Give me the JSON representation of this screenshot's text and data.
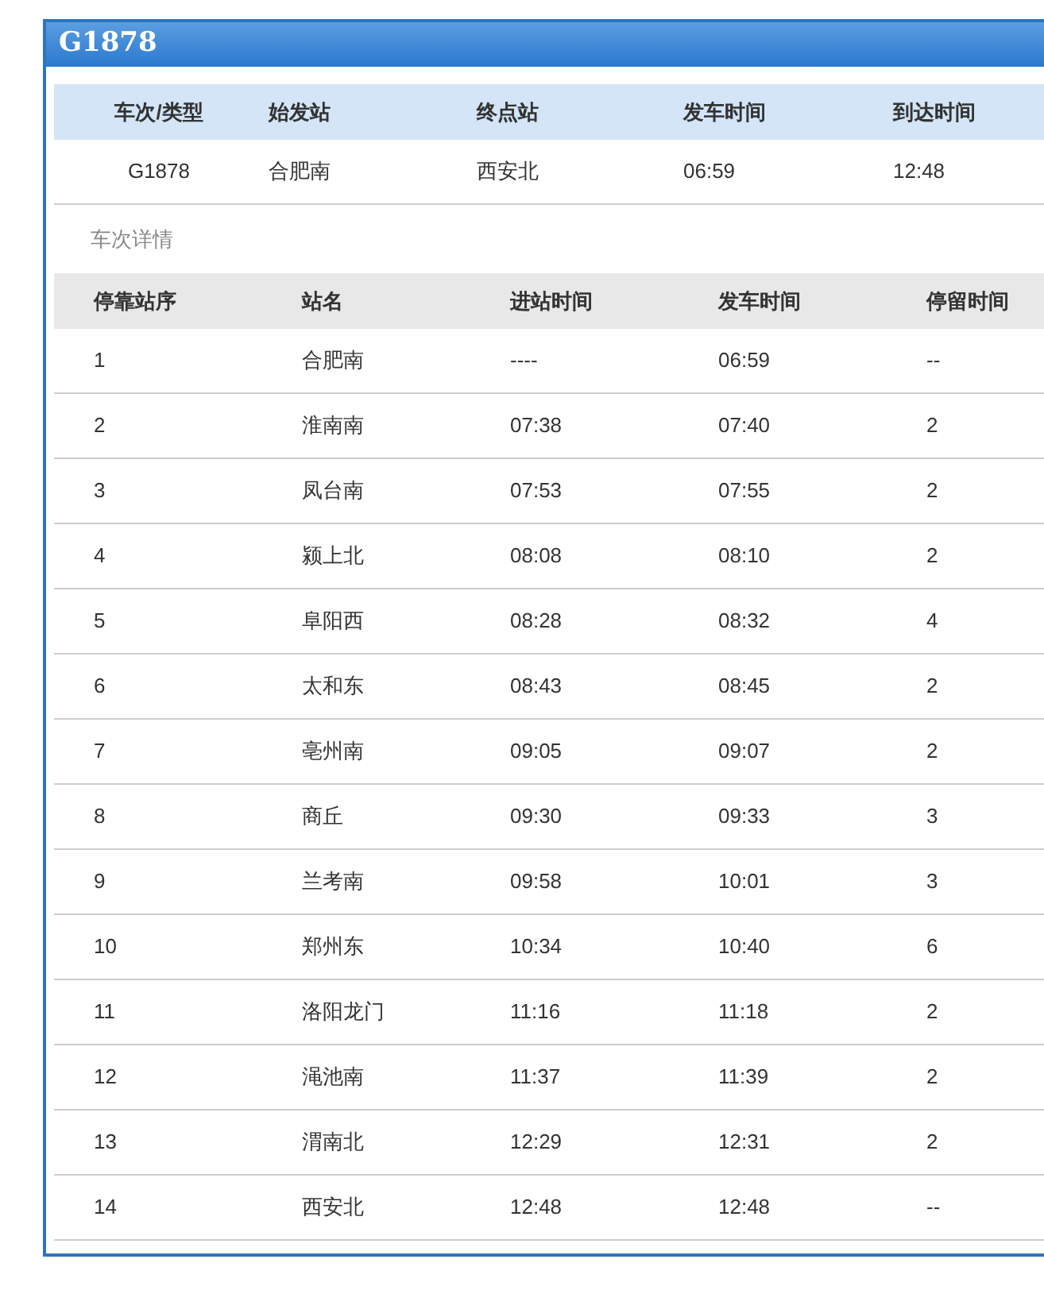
{
  "panel": {
    "title": "G1878"
  },
  "summary": {
    "columns": [
      "车次/类型",
      "始发站",
      "终点站",
      "发车时间",
      "到达时间"
    ],
    "row": [
      "G1878",
      "合肥南",
      "西安北",
      "06:59",
      "12:48"
    ]
  },
  "details": {
    "heading": "车次详情",
    "columns": [
      "停靠站序",
      "站名",
      "进站时间",
      "发车时间",
      "停留时间"
    ],
    "rows": [
      [
        "1",
        "合肥南",
        "----",
        "06:59",
        "--"
      ],
      [
        "2",
        "淮南南",
        "07:38",
        "07:40",
        "2"
      ],
      [
        "3",
        "凤台南",
        "07:53",
        "07:55",
        "2"
      ],
      [
        "4",
        "颍上北",
        "08:08",
        "08:10",
        "2"
      ],
      [
        "5",
        "阜阳西",
        "08:28",
        "08:32",
        "4"
      ],
      [
        "6",
        "太和东",
        "08:43",
        "08:45",
        "2"
      ],
      [
        "7",
        "亳州南",
        "09:05",
        "09:07",
        "2"
      ],
      [
        "8",
        "商丘",
        "09:30",
        "09:33",
        "3"
      ],
      [
        "9",
        "兰考南",
        "09:58",
        "10:01",
        "3"
      ],
      [
        "10",
        "郑州东",
        "10:34",
        "10:40",
        "6"
      ],
      [
        "11",
        "洛阳龙门",
        "11:16",
        "11:18",
        "2"
      ],
      [
        "12",
        "渑池南",
        "11:37",
        "11:39",
        "2"
      ],
      [
        "13",
        "渭南北",
        "12:29",
        "12:31",
        "2"
      ],
      [
        "14",
        "西安北",
        "12:48",
        "12:48",
        "--"
      ]
    ]
  }
}
